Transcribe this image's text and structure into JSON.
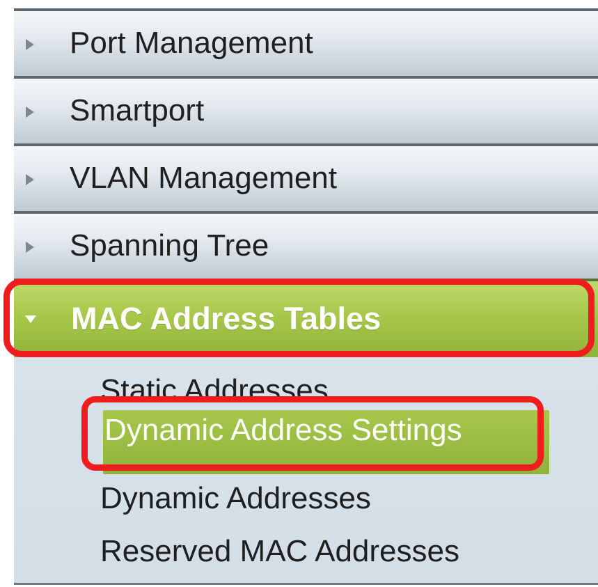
{
  "sidebar": {
    "items": [
      {
        "label": "Port Management",
        "expanded": false,
        "icon": "chevron-right-icon"
      },
      {
        "label": "Smartport",
        "expanded": false,
        "icon": "chevron-right-icon"
      },
      {
        "label": "VLAN Management",
        "expanded": false,
        "icon": "chevron-right-icon"
      },
      {
        "label": "Spanning Tree",
        "expanded": false,
        "icon": "chevron-right-icon"
      },
      {
        "label": "MAC Address Tables",
        "expanded": true,
        "icon": "chevron-down-icon"
      }
    ],
    "submenu": [
      {
        "label": "Static Addresses",
        "selected": false
      },
      {
        "label": "Dynamic Address Settings",
        "selected": true
      },
      {
        "label": "Dynamic Addresses",
        "selected": false
      },
      {
        "label": "Reserved MAC Addresses",
        "selected": false
      }
    ]
  },
  "colors": {
    "active_green": "#a8c84b",
    "highlight_red": "#ef1d1d",
    "menu_gray": "#dfe6ec"
  }
}
